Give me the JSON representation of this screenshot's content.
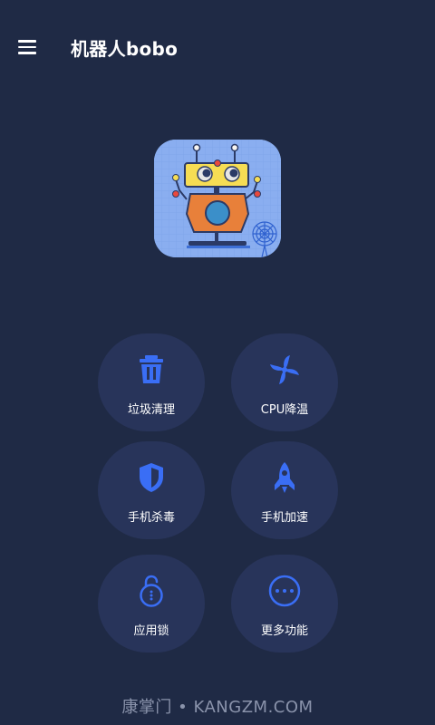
{
  "app": {
    "title": "机器人bobo"
  },
  "tiles": [
    {
      "label": "垃圾清理",
      "icon": "trash-icon"
    },
    {
      "label": "CPU降温",
      "icon": "fan-icon"
    },
    {
      "label": "手机杀毒",
      "icon": "shield-icon"
    },
    {
      "label": "手机加速",
      "icon": "rocket-icon"
    },
    {
      "label": "应用锁",
      "icon": "unlock-icon"
    },
    {
      "label": "更多功能",
      "icon": "more-icon"
    }
  ],
  "colors": {
    "background": "#1f2a45",
    "tile": "#28345a",
    "icon_blue": "#3a6ef5",
    "text": "#ffffff"
  },
  "watermark": "康掌门 • KANGZM.COM"
}
